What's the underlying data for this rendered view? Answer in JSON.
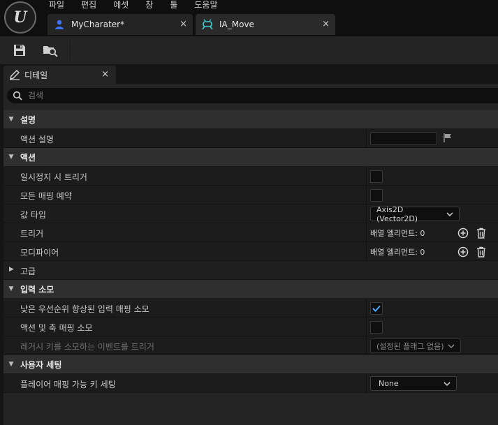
{
  "menubar": {
    "items": [
      "파일",
      "편집",
      "에셋",
      "창",
      "툴",
      "도움말"
    ]
  },
  "tabs": [
    {
      "label": "MyCharater*",
      "icon": "character-icon",
      "close": "×"
    },
    {
      "label": "IA_Move",
      "icon": "input-action-icon",
      "close": "×"
    }
  ],
  "toolbar": {
    "save_icon": "save-icon",
    "browse_icon": "browse-icon"
  },
  "details_tab": {
    "label": "디테일",
    "close": "×"
  },
  "search": {
    "placeholder": "검색"
  },
  "categories": {
    "description": "설명",
    "action": "액션",
    "input_consumption": "입력 소모",
    "user_settings": "사용자 세팅"
  },
  "properties": {
    "action_description": "액션 설명",
    "trigger_when_paused": "일시정지 시 트리거",
    "reserve_all_mappings": "모든 매핑 예약",
    "value_type": "값 타입",
    "value_type_selected": "Axis2D (Vector2D)",
    "triggers": "트리거",
    "triggers_value": "배열 엘리먼트: 0",
    "modifiers": "모디파이어",
    "modifiers_value": "배열 엘리먼트: 0",
    "advanced": "고급",
    "consume_lower_priority": "낮은 우선순위 향상된 입력 매핑 소모",
    "consume_lower_priority_checked": true,
    "consume_action_axis": "액션 및 축 매핑 소모",
    "consume_action_axis_checked": false,
    "trigger_legacy_events": "레거시 키를 소모하는 이벤트를 트리거",
    "trigger_legacy_events_value": "(설정된 플래그 없음)",
    "player_mappable_settings": "플레이어 매핑 가능 키 세팅",
    "player_mappable_value": "None"
  },
  "colors": {
    "accent_check": "#4aa8ff",
    "tab_character_icon": "#3f73ff",
    "tab_input_icon": "#3ecfd6"
  }
}
